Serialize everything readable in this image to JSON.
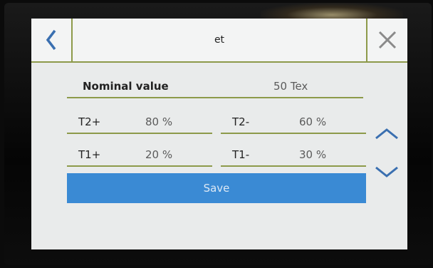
{
  "header": {
    "title": "et",
    "back_icon": "chevron-left-icon",
    "close_icon": "close-icon"
  },
  "form": {
    "nominal": {
      "label": "Nominal value",
      "value": "50 Tex"
    },
    "fields": [
      {
        "label": "T2+",
        "value": "80 %"
      },
      {
        "label": "T2-",
        "value": "60 %"
      },
      {
        "label": "T1+",
        "value": "20 %"
      },
      {
        "label": "T1-",
        "value": "30 %"
      }
    ]
  },
  "actions": {
    "save_label": "Save"
  },
  "scroll": {
    "up_icon": "chevron-up-icon",
    "down_icon": "chevron-down-icon"
  },
  "colors": {
    "accent_line": "#8d9a4a",
    "save_button": "#3a8ad4",
    "icon_blue": "#3a6fb0",
    "close_gray": "#8a8a8a"
  }
}
